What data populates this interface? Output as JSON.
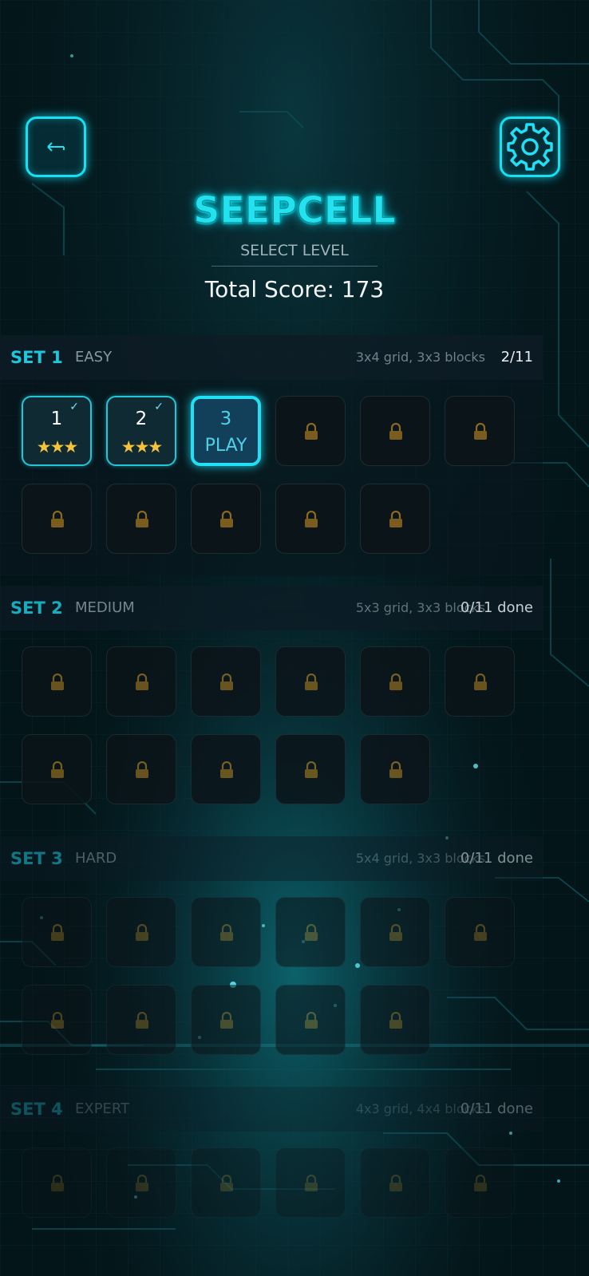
{
  "title": "SEEPCELL",
  "subtitle": "SELECT LEVEL",
  "total_score": "Total Score: 173",
  "icons": {
    "back": "back-arrow-icon",
    "settings": "gear-icon",
    "lock": "lock-icon",
    "check": "check-icon",
    "stars": "star-icon"
  },
  "colors": {
    "accent": "#1fe0f5",
    "star": "#f4c23c",
    "background": "#031519"
  },
  "sets": [
    {
      "name": "SET 1",
      "difficulty": "EASY",
      "info": "3x4 grid, 3x3 blocks",
      "progress": "2/11",
      "levels": [
        {
          "state": "done",
          "num": "1",
          "stars": "★★★",
          "check": "✓"
        },
        {
          "state": "done",
          "num": "2",
          "stars": "★★★",
          "check": "✓"
        },
        {
          "state": "current",
          "num": "3",
          "play": "PLAY"
        },
        {
          "state": "locked"
        },
        {
          "state": "locked"
        },
        {
          "state": "locked"
        },
        {
          "state": "locked"
        },
        {
          "state": "locked"
        },
        {
          "state": "locked"
        },
        {
          "state": "locked"
        },
        {
          "state": "locked"
        }
      ]
    },
    {
      "name": "SET 2",
      "difficulty": "MEDIUM",
      "info": "5x3 grid, 3x3 blocks",
      "progress": "0/11 done",
      "levels": [
        {
          "state": "locked"
        },
        {
          "state": "locked"
        },
        {
          "state": "locked"
        },
        {
          "state": "locked"
        },
        {
          "state": "locked"
        },
        {
          "state": "locked"
        },
        {
          "state": "locked"
        },
        {
          "state": "locked"
        },
        {
          "state": "locked"
        },
        {
          "state": "locked"
        },
        {
          "state": "locked"
        }
      ]
    },
    {
      "name": "SET 3",
      "difficulty": "HARD",
      "info": "5x4 grid, 3x3 blocks",
      "progress": "0/11 done",
      "levels": [
        {
          "state": "locked"
        },
        {
          "state": "locked"
        },
        {
          "state": "locked"
        },
        {
          "state": "locked"
        },
        {
          "state": "locked"
        },
        {
          "state": "locked"
        },
        {
          "state": "locked"
        },
        {
          "state": "locked"
        },
        {
          "state": "locked"
        },
        {
          "state": "locked"
        },
        {
          "state": "locked"
        }
      ]
    },
    {
      "name": "SET 4",
      "difficulty": "EXPERT",
      "info": "4x3 grid, 4x4 blocks",
      "progress": "0/11 done",
      "levels": [
        {
          "state": "locked"
        },
        {
          "state": "locked"
        },
        {
          "state": "locked"
        },
        {
          "state": "locked"
        },
        {
          "state": "locked"
        },
        {
          "state": "locked"
        }
      ]
    }
  ]
}
